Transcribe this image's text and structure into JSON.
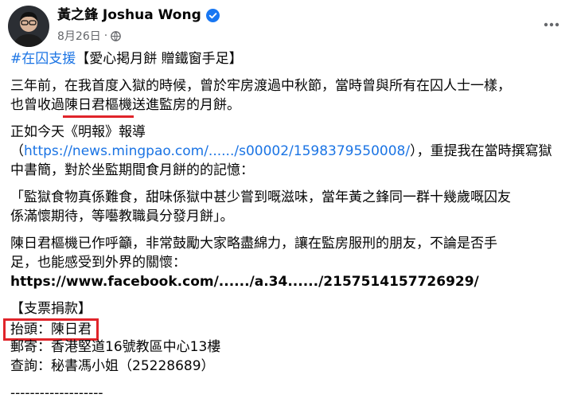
{
  "author": {
    "name": "黃之鋒 Joshua Wong",
    "date": "8月26日",
    "separator": "·"
  },
  "icons": {
    "verified": "verified-badge-icon",
    "privacy": "globe-icon",
    "more": "more-options-icon"
  },
  "colors": {
    "link": "#1b74e4",
    "highlight": "#e0242a",
    "secondary_text": "#65676b"
  },
  "post": {
    "hashtag": "#在囚支援",
    "title": "【愛心掲月餅 贈鐵窗手足】",
    "p1_line1": "三年前，在我首度入獄的時候，曾於牢房渡過中秋節，當時曾與所有在囚人士一樣，",
    "p1_line2_pre": "也曾收過",
    "p1_line2_highlight": "陳日君樞機",
    "p1_line2_post": "送進監房的月餅。",
    "p2_line1": "正如今天《明報》報導",
    "p2_paren_open": "（",
    "p2_link": "https://news.mingpao.com/....../s00002/1598379550008/",
    "p2_line2_post": "），重提我在當時撰寫獄",
    "p2_line3": "中書簡，對於坐監期間食月餅的的記憶：",
    "quote_line1": "「監獄食物真係難食，甜味係獄中甚少嘗到嘅滋味，當年黃之鋒同一群十幾歲嘅囚友",
    "quote_line2": "係滿懷期待，等囈教職員分發月餅」。",
    "p3_line1": "陳日君樞機已作呼籲，非常鼓勵大家略盡綿力，讓在監房服刑的朋友，不論是否手",
    "p3_line2": "足，也能感受到外界的關懷：",
    "fb_link": "https://www.facebook.com/....../a.34....../2157514157726929/",
    "support_heading": "【支票捐款】",
    "payee": "抬頭：陳日君",
    "address": "郵寄：香港堅道16號教區中心13樓",
    "enquiry": "查詢：秘書馮小姐（25228689）",
    "divider": "-------------------"
  }
}
